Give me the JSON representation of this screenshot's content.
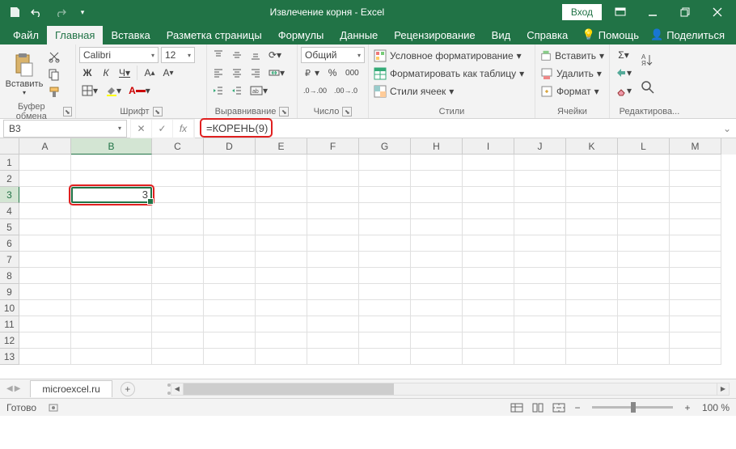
{
  "titlebar": {
    "doc_title": "Извлечение корня  -  Excel",
    "login": "Вход"
  },
  "tabs": {
    "file": "Файл",
    "home": "Главная",
    "insert": "Вставка",
    "layout": "Разметка страницы",
    "formulas": "Формулы",
    "data": "Данные",
    "review": "Рецензирование",
    "view": "Вид",
    "help": "Справка",
    "tellme": "Помощь",
    "share": "Поделиться"
  },
  "ribbon": {
    "clipboard": {
      "label": "Буфер обмена",
      "paste": "Вставить"
    },
    "font": {
      "label": "Шрифт",
      "name": "Calibri",
      "size": "12",
      "bold": "Ж",
      "italic": "К",
      "underline": "Ч"
    },
    "alignment": {
      "label": "Выравнивание"
    },
    "number": {
      "label": "Число",
      "format": "Общий"
    },
    "styles": {
      "label": "Стили",
      "cond": "Условное форматирование",
      "table": "Форматировать как таблицу",
      "cell": "Стили ячеек"
    },
    "cells": {
      "label": "Ячейки",
      "insert": "Вставить",
      "delete": "Удалить",
      "format": "Формат"
    },
    "editing": {
      "label": "Редактирова..."
    }
  },
  "formula_bar": {
    "cell_ref": "B3",
    "formula": "=КОРЕНЬ(9)"
  },
  "grid": {
    "cols": [
      "A",
      "B",
      "C",
      "D",
      "E",
      "F",
      "G",
      "H",
      "I",
      "J",
      "K",
      "L",
      "M"
    ],
    "rows": [
      "1",
      "2",
      "3",
      "4",
      "5",
      "6",
      "7",
      "8",
      "9",
      "10",
      "11",
      "12",
      "13"
    ],
    "selected_col": "B",
    "selected_row": "3",
    "b3_value": "3"
  },
  "sheets": {
    "active": "microexcel.ru"
  },
  "statusbar": {
    "ready": "Готово",
    "zoom": "100 %"
  }
}
